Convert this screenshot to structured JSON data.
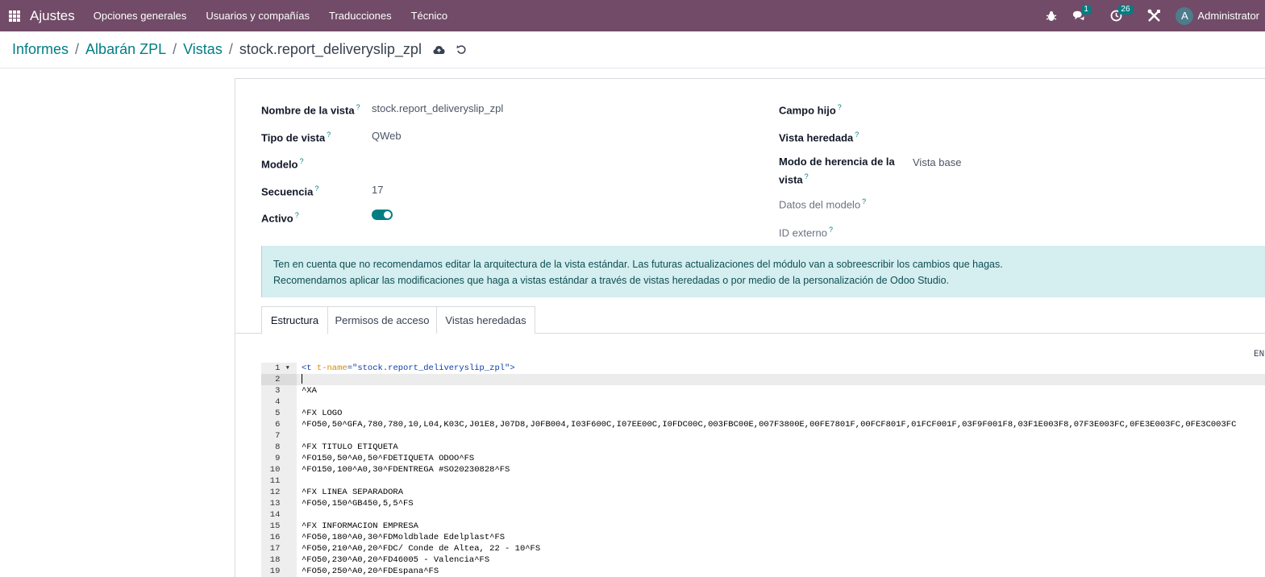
{
  "navbar": {
    "app_name": "Ajustes",
    "menu": [
      "Opciones generales",
      "Usuarios y compañías",
      "Traducciones",
      "Técnico"
    ],
    "messages_count": "1",
    "activities_count": "26",
    "avatar_letter": "A",
    "user_name": "Administrator",
    "bg_color": "#714b67"
  },
  "breadcrumb": {
    "items": [
      "Informes",
      "Albarán ZPL",
      "Vistas"
    ],
    "current": "stock.report_deliveryslip_zpl"
  },
  "form": {
    "left": {
      "view_name_label": "Nombre de la vista",
      "view_name_value": "stock.report_deliveryslip_zpl",
      "view_type_label": "Tipo de vista",
      "view_type_value": "QWeb",
      "model_label": "Modelo",
      "sequence_label": "Secuencia",
      "sequence_value": "17",
      "active_label": "Activo",
      "active_value": true
    },
    "right": {
      "child_field_label": "Campo hijo",
      "inherited_view_label": "Vista heredada",
      "inherit_mode_label_1": "Modo de herencia de la",
      "inherit_mode_label_2": "vista",
      "inherit_mode_value": "Vista base",
      "model_data_label": "Datos del modelo",
      "external_id_label": "ID externo"
    },
    "help_marker": "?"
  },
  "alert": {
    "line1": "Ten en cuenta que no recomendamos editar la arquitectura de la vista estándar. Las futuras actualizaciones del módulo van a sobreescribir los cambios que hagas.",
    "line2": "Recomendamos aplicar las modificaciones que haga a vistas estándar a través de vistas heredadas o por medio de la personalización de Odoo Studio."
  },
  "tabs": [
    "Estructura",
    "Permisos de acceso",
    "Vistas heredadas"
  ],
  "editor": {
    "lang_label": "EN",
    "lines": [
      "<t t-name=\"stock.report_deliveryslip_zpl\">",
      "",
      "^XA",
      "",
      "^FX LOGO",
      "^FO50,50^GFA,780,780,10,L04,K03C,J01E8,J07D8,J0FB004,I03F600C,I07EE00C,I0FDC00C,003FBC00E,007F3800E,00FE7801F,00FCF801F,01FCF001F,03F9F001F8,03F1E003F8,07F3E003FC,0FE3E003FC,0FE3C003FC",
      "",
      "^FX TITULO ETIQUETA",
      "^FO150,50^A0,50^FDETIQUETA ODOO^FS",
      "^FO150,100^A0,30^FDENTREGA #SO20230828^FS",
      "",
      "^FX LINEA SEPARADORA",
      "^FO50,150^GB450,5,5^FS",
      "",
      "^FX INFORMACION EMPRESA",
      "^FO50,180^A0,30^FDMoldblade Edelplast^FS",
      "^FO50,210^A0,20^FDC/ Conde de Altea, 22 - 10^FS",
      "^FO50,230^A0,20^FD46005 - Valencia^FS",
      "^FO50,250^A0,20^FDEspana^FS"
    ]
  }
}
